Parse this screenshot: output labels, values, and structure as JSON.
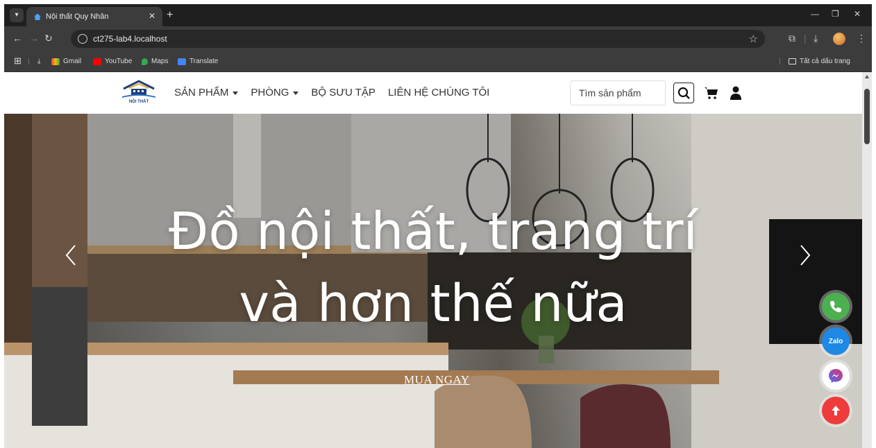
{
  "browser": {
    "tab_title": "Nội thất Quy Nhân",
    "url": "ct275-lab4.localhost",
    "bookmarks": [
      {
        "label": "Gmail",
        "icon": "gmail-icon"
      },
      {
        "label": "YouTube",
        "icon": "youtube-icon"
      },
      {
        "label": "Maps",
        "icon": "maps-icon"
      },
      {
        "label": "Translate",
        "icon": "translate-icon"
      }
    ],
    "all_bookmarks_label": "Tất cả dấu trang"
  },
  "site": {
    "logo_text": "NỘI THẤT",
    "menu": [
      {
        "label": "SẢN PHẨM",
        "dropdown": true
      },
      {
        "label": "PHÒNG",
        "dropdown": true
      },
      {
        "label": "BỘ SƯU TẬP",
        "dropdown": false
      },
      {
        "label": "LIÊN HỆ CHÚNG TÔI",
        "dropdown": false
      }
    ],
    "search_placeholder": "Tìm sản phẩm"
  },
  "hero": {
    "line1": "Đồ nội thất, trang trí",
    "line2": "và hơn thế nữa",
    "cta": "MUA NGAY"
  },
  "floating_buttons": [
    {
      "name": "phone-button",
      "color": "#4caf50"
    },
    {
      "name": "zalo-button",
      "color": "#1e88e5",
      "label": "Zalo"
    },
    {
      "name": "messenger-button",
      "color": "#ffffff"
    },
    {
      "name": "back-to-top-button",
      "color": "#ef3b3b"
    }
  ],
  "colors": {
    "chrome_dark": "#1f1f1f",
    "chrome_mid": "#3c3c3c",
    "accent_green": "#4caf50",
    "accent_blue": "#1e88e5",
    "accent_red": "#ef3b3b"
  }
}
